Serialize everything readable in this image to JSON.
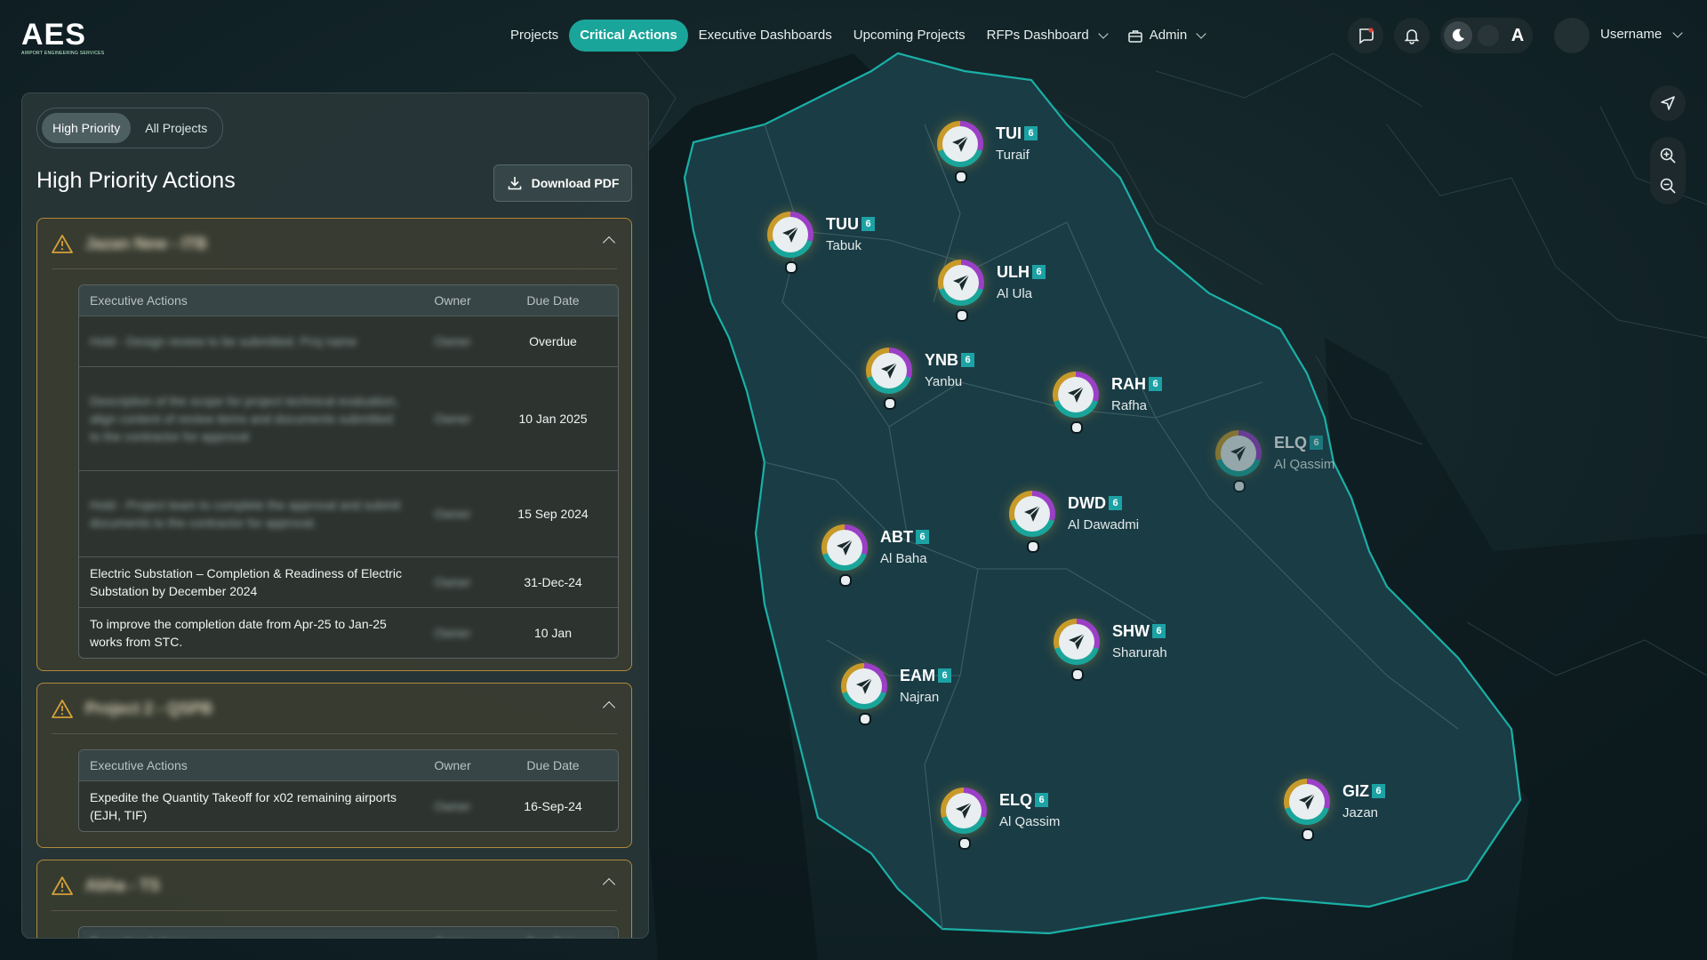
{
  "logo": {
    "main": "AES",
    "sub": "AIRPORT ENGINEERING SERVICES"
  },
  "nav": {
    "items": [
      {
        "label": "Projects",
        "active": false
      },
      {
        "label": "Critical Actions",
        "active": true
      },
      {
        "label": "Executive Dashboards",
        "active": false
      },
      {
        "label": "Upcoming Projects",
        "active": false
      }
    ],
    "rfps_label": "RFPs Dashboard",
    "admin_label": "Admin"
  },
  "user": {
    "name": "Username"
  },
  "theme": {
    "mode": "dark",
    "accent": "#1aa59a"
  },
  "panel": {
    "tabs": [
      {
        "label": "High Priority",
        "selected": true
      },
      {
        "label": "All Projects",
        "selected": false
      }
    ],
    "title": "High Priority Actions",
    "download_label": "Download PDF",
    "table_headers": {
      "action": "Executive Actions",
      "owner": "Owner",
      "due": "Due Date"
    },
    "cards": [
      {
        "title_blurred": "Jazan New - ITB",
        "rows": [
          {
            "action": "Hold - Design review to be submitted. Proj name",
            "owner": "Owner",
            "due": "Overdue"
          },
          {
            "action": "Description of the scope for project technical evaluation, align content of review items and documents submitted to the contractor for approval",
            "owner": "Owner",
            "due": "10 Jan 2025"
          },
          {
            "action": "Hold - Project team to complete the approval and submit documents to the contractor for approval.",
            "owner": "Owner",
            "due": "15 Sep 2024"
          },
          {
            "action": "Electric Substation – Completion & Readiness of Electric Substation by December 2024",
            "owner": "Owner",
            "due": "31-Dec-24"
          },
          {
            "action": "To improve the completion date from Apr-25 to Jan-25 works from STC.",
            "owner": "Owner",
            "due": "10 Jan"
          }
        ]
      },
      {
        "title_blurred": "Project 2 - QSPB",
        "rows": [
          {
            "action": "Expedite the Quantity Takeoff for x02 remaining airports (EJH, TIF)",
            "owner": "Owner",
            "due": "16-Sep-24"
          }
        ]
      },
      {
        "title_blurred": "Abha - TS",
        "rows": []
      }
    ]
  },
  "airports": [
    {
      "code": "TUI",
      "city": "Turaif",
      "count": "6",
      "dim": false
    },
    {
      "code": "TUU",
      "city": "Tabuk",
      "count": "6",
      "dim": false
    },
    {
      "code": "ULH",
      "city": "Al Ula",
      "count": "6",
      "dim": false
    },
    {
      "code": "YNB",
      "city": "Yanbu",
      "count": "6",
      "dim": false
    },
    {
      "code": "RAH",
      "city": "Rafha",
      "count": "6",
      "dim": false
    },
    {
      "code": "ELQ",
      "city": "Al Qassim",
      "count": "6",
      "dim": true
    },
    {
      "code": "DWD",
      "city": "Al Dawadmi",
      "count": "6",
      "dim": false
    },
    {
      "code": "ABT",
      "city": "Al Baha",
      "count": "6",
      "dim": false
    },
    {
      "code": "SHW",
      "city": "Sharurah",
      "count": "6",
      "dim": false
    },
    {
      "code": "EAM",
      "city": "Najran",
      "count": "6",
      "dim": false
    },
    {
      "code": "ELQ",
      "city": "Al Qassim",
      "count": "6",
      "dim": false
    },
    {
      "code": "GIZ",
      "city": "Jazan",
      "count": "6",
      "dim": false
    }
  ]
}
